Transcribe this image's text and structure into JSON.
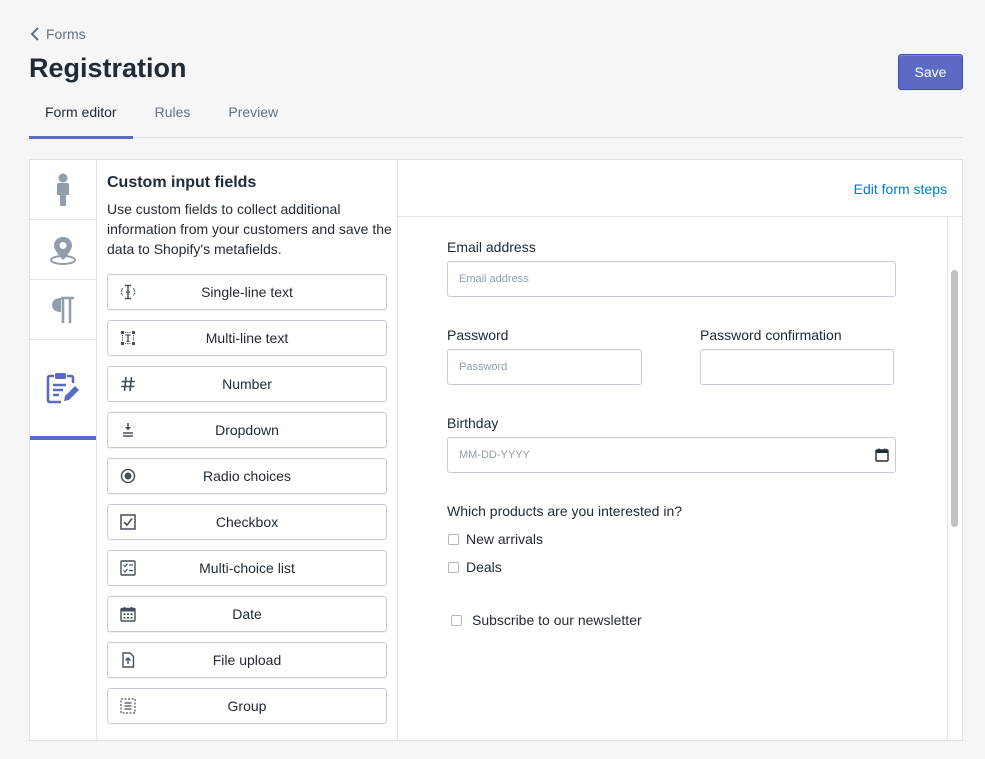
{
  "breadcrumb": {
    "label": "Forms"
  },
  "page": {
    "title": "Registration"
  },
  "actions": {
    "save_label": "Save"
  },
  "tabs": [
    {
      "label": "Form editor",
      "active": true
    },
    {
      "label": "Rules",
      "active": false
    },
    {
      "label": "Preview",
      "active": false
    }
  ],
  "rail": {
    "items": [
      {
        "icon": "person-icon"
      },
      {
        "icon": "location-pin-icon"
      },
      {
        "icon": "pilcrow-icon"
      },
      {
        "icon": "clipboard-edit-icon",
        "active": true
      }
    ]
  },
  "custom_fields": {
    "title": "Custom input fields",
    "description": "Use custom fields to collect additional information from your customers and save the data to Shopify's metafields.",
    "buttons": [
      {
        "label": "Single-line text",
        "icon": "text-cursor-icon"
      },
      {
        "label": "Multi-line text",
        "icon": "text-block-icon"
      },
      {
        "label": "Number",
        "icon": "hash-icon"
      },
      {
        "label": "Dropdown",
        "icon": "dropdown-icon"
      },
      {
        "label": "Radio choices",
        "icon": "radio-icon"
      },
      {
        "label": "Checkbox",
        "icon": "checkbox-icon"
      },
      {
        "label": "Multi-choice list",
        "icon": "checklist-icon"
      },
      {
        "label": "Date",
        "icon": "calendar-icon"
      },
      {
        "label": "File upload",
        "icon": "file-upload-icon"
      },
      {
        "label": "Group",
        "icon": "group-icon"
      }
    ]
  },
  "preview": {
    "edit_steps_label": "Edit form steps",
    "email": {
      "label": "Email address",
      "placeholder": "Email address"
    },
    "password": {
      "label": "Password",
      "placeholder": "Password"
    },
    "password_confirmation": {
      "label": "Password confirmation",
      "placeholder": ""
    },
    "birthday": {
      "label": "Birthday",
      "placeholder": "MM-DD-YYYY"
    },
    "products_question": "Which products are you interested in?",
    "products_options": [
      "New arrivals",
      "Deals"
    ],
    "newsletter_label": "Subscribe to our newsletter"
  },
  "colors": {
    "accent": "#5c6ac4",
    "link": "#007ace",
    "icon_gray": "#919eab",
    "icon_active": "#5c6ac4"
  }
}
